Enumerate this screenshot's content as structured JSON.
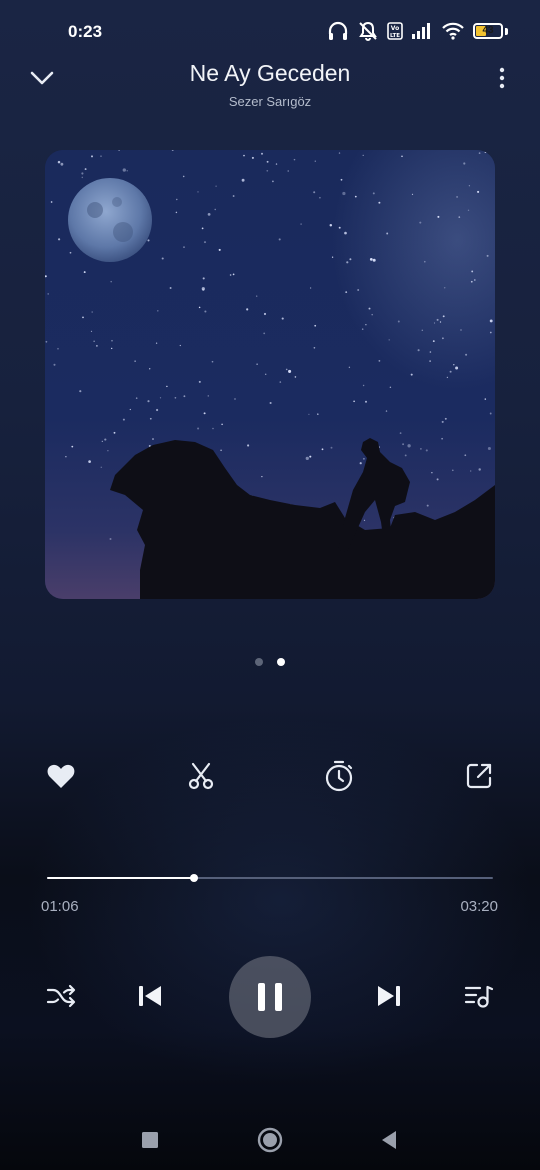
{
  "status_bar": {
    "time": "0:23",
    "battery_level": "43",
    "icons": [
      "headphones-icon",
      "bell-muted-icon",
      "volte-icon",
      "signal-icon",
      "wifi-icon",
      "battery-icon"
    ]
  },
  "header": {
    "title": "Ne Ay Geceden",
    "artist": "Sezer Sarıgöz",
    "icons": [
      "chevron-down-icon",
      "more-vertical-icon"
    ]
  },
  "artwork": {
    "description_icon": "album-art-image"
  },
  "pager": {
    "count": 2,
    "active_index": 1
  },
  "actions": {
    "icons": [
      "heart-icon",
      "scissors-icon",
      "timer-icon",
      "share-icon"
    ]
  },
  "playback": {
    "elapsed": "01:06",
    "total": "03:20",
    "progress_fraction": 0.33
  },
  "controls": {
    "icons": [
      "shuffle-icon",
      "skip-previous-icon",
      "pause-icon",
      "skip-next-icon",
      "queue-icon"
    ]
  },
  "nav": {
    "icons": [
      "recents-icon",
      "home-icon",
      "back-icon"
    ]
  },
  "colors": {
    "accent": "#ffffff",
    "battery": "#f2c230",
    "background_top": "#1a2544",
    "background_bottom": "#05070c"
  }
}
